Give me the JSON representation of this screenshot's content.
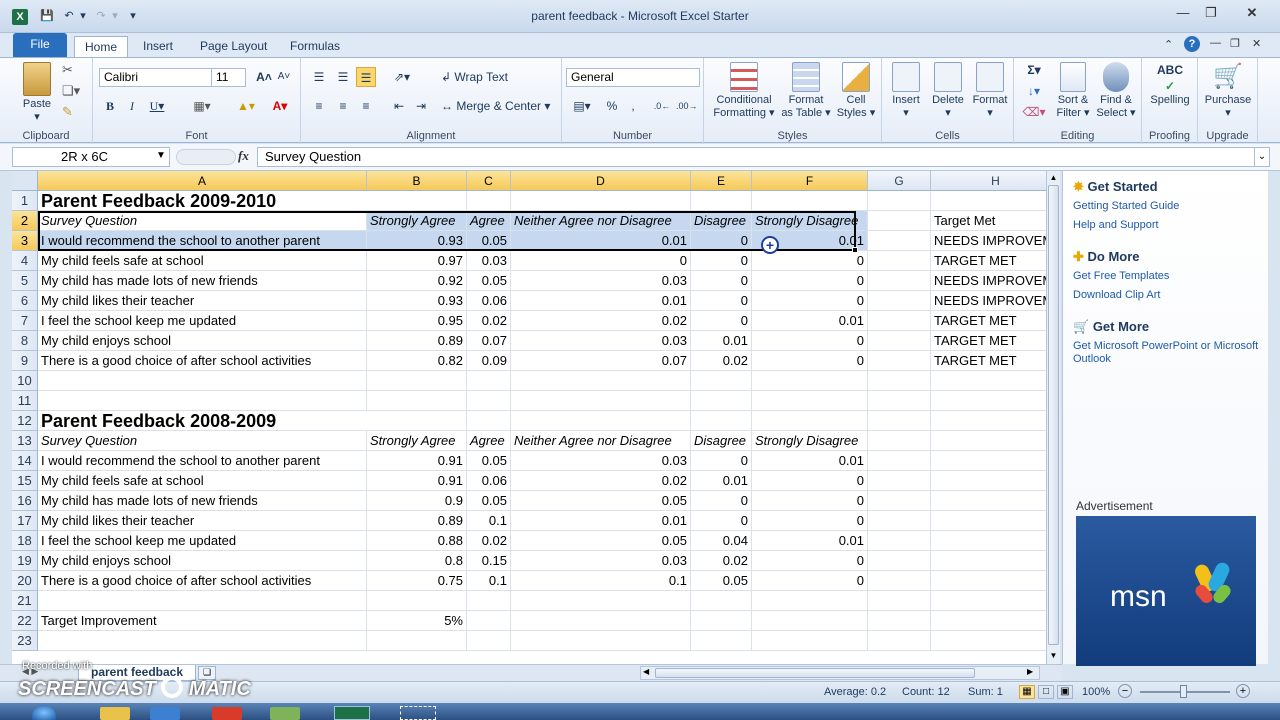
{
  "window": {
    "title": "parent feedback  -  Microsoft Excel Starter"
  },
  "tabs": {
    "file": "File",
    "items": [
      "Home",
      "Insert",
      "Page Layout",
      "Formulas"
    ]
  },
  "ribbon": {
    "clipboard": {
      "label": "Clipboard",
      "paste": "Paste"
    },
    "font": {
      "label": "Font",
      "name": "Calibri",
      "size": "11"
    },
    "alignment": {
      "label": "Alignment",
      "wrap": "Wrap Text",
      "merge": "Merge & Center"
    },
    "number": {
      "label": "Number",
      "format": "General"
    },
    "styles": {
      "label": "Styles",
      "conditional": "Conditional",
      "conditional2": "Formatting",
      "format_table": "Format",
      "format_table2": "as Table",
      "cell_styles": "Cell",
      "cell_styles2": "Styles"
    },
    "cells": {
      "label": "Cells",
      "insert": "Insert",
      "delete": "Delete",
      "format": "Format"
    },
    "editing": {
      "label": "Editing",
      "sort": "Sort &",
      "sort2": "Filter",
      "find": "Find &",
      "find2": "Select"
    },
    "proofing": {
      "label": "Proofing",
      "spelling": "Spelling"
    },
    "upgrade": {
      "label": "Upgrade",
      "purchase": "Purchase"
    }
  },
  "formula": {
    "namebox": "2R x 6C",
    "fx": "fx",
    "value": "Survey Question"
  },
  "columns": [
    "A",
    "B",
    "C",
    "D",
    "E",
    "F",
    "G",
    "H"
  ],
  "rows": [
    {
      "n": "1",
      "a": "Parent Feedback 2009-2010",
      "type": "title"
    },
    {
      "n": "2",
      "a": "Survey Question",
      "b": "Strongly Agree",
      "c": "Agree",
      "d": "Neither Agree nor Disagree",
      "e": "Disagree",
      "f": "Strongly Disagree",
      "h": "Target Met",
      "type": "header"
    },
    {
      "n": "3",
      "a": "I would recommend the school to another parent",
      "b": "0.93",
      "c": "0.05",
      "d": "0.01",
      "e": "0",
      "f": "0.01",
      "h": "NEEDS IMPROVEMENT"
    },
    {
      "n": "4",
      "a": "My child feels safe at school",
      "b": "0.97",
      "c": "0.03",
      "d": "0",
      "e": "0",
      "f": "0",
      "h": "TARGET MET"
    },
    {
      "n": "5",
      "a": "My child has made lots of new friends",
      "b": "0.92",
      "c": "0.05",
      "d": "0.03",
      "e": "0",
      "f": "0",
      "h": "NEEDS IMPROVEMENT"
    },
    {
      "n": "6",
      "a": "My child likes their teacher",
      "b": "0.93",
      "c": "0.06",
      "d": "0.01",
      "e": "0",
      "f": "0",
      "h": "NEEDS IMPROVEMENT"
    },
    {
      "n": "7",
      "a": "I feel the school keep me updated",
      "b": "0.95",
      "c": "0.02",
      "d": "0.02",
      "e": "0",
      "f": "0.01",
      "h": "TARGET MET"
    },
    {
      "n": "8",
      "a": "My child enjoys school",
      "b": "0.89",
      "c": "0.07",
      "d": "0.03",
      "e": "0.01",
      "f": "0",
      "h": "TARGET MET"
    },
    {
      "n": "9",
      "a": "There is a good choice of after school activities",
      "b": "0.82",
      "c": "0.09",
      "d": "0.07",
      "e": "0.02",
      "f": "0",
      "h": "TARGET MET"
    },
    {
      "n": "10"
    },
    {
      "n": "11"
    },
    {
      "n": "12",
      "a": "Parent Feedback 2008-2009",
      "type": "title"
    },
    {
      "n": "13",
      "a": "Survey Question",
      "b": "Strongly Agree",
      "c": "Agree",
      "d": "Neither Agree nor Disagree",
      "e": "Disagree",
      "f": "Strongly Disagree",
      "type": "header"
    },
    {
      "n": "14",
      "a": "I would recommend the school to another parent",
      "b": "0.91",
      "c": "0.05",
      "d": "0.03",
      "e": "0",
      "f": "0.01"
    },
    {
      "n": "15",
      "a": "My child feels safe at school",
      "b": "0.91",
      "c": "0.06",
      "d": "0.02",
      "e": "0.01",
      "f": "0"
    },
    {
      "n": "16",
      "a": "My child has made lots of new friends",
      "b": "0.9",
      "c": "0.05",
      "d": "0.05",
      "e": "0",
      "f": "0"
    },
    {
      "n": "17",
      "a": "My child likes their teacher",
      "b": "0.89",
      "c": "0.1",
      "d": "0.01",
      "e": "0",
      "f": "0"
    },
    {
      "n": "18",
      "a": "I feel the school keep me updated",
      "b": "0.88",
      "c": "0.02",
      "d": "0.05",
      "e": "0.04",
      "f": "0.01"
    },
    {
      "n": "19",
      "a": "My child enjoys school",
      "b": "0.8",
      "c": "0.15",
      "d": "0.03",
      "e": "0.02",
      "f": "0"
    },
    {
      "n": "20",
      "a": "There is a good choice of after school activities",
      "b": "0.75",
      "c": "0.1",
      "d": "0.1",
      "e": "0.05",
      "f": "0"
    },
    {
      "n": "21"
    },
    {
      "n": "22",
      "a": "Target Improvement",
      "b": "5%"
    },
    {
      "n": "23"
    }
  ],
  "pane": {
    "get_started": "Get Started",
    "gs_link1": "Getting Started Guide",
    "gs_link2": "Help and Support",
    "do_more": "Do More",
    "dm_link1": "Get Free Templates",
    "dm_link2": "Download Clip Art",
    "get_more": "Get More",
    "gm_link1": "Get Microsoft PowerPoint or Microsoft",
    "gm_link2": "Outlook",
    "ad_label": "Advertisement",
    "ad_brand": "msn"
  },
  "sheet": {
    "tab": "parent feedback"
  },
  "status": {
    "average": "Average: 0.2",
    "count": "Count: 12",
    "sum": "Sum: 1",
    "zoom": "100%"
  },
  "watermark": {
    "line1": "Recorded with",
    "line2": "SCREENCAST",
    "line3": "MATIC"
  }
}
